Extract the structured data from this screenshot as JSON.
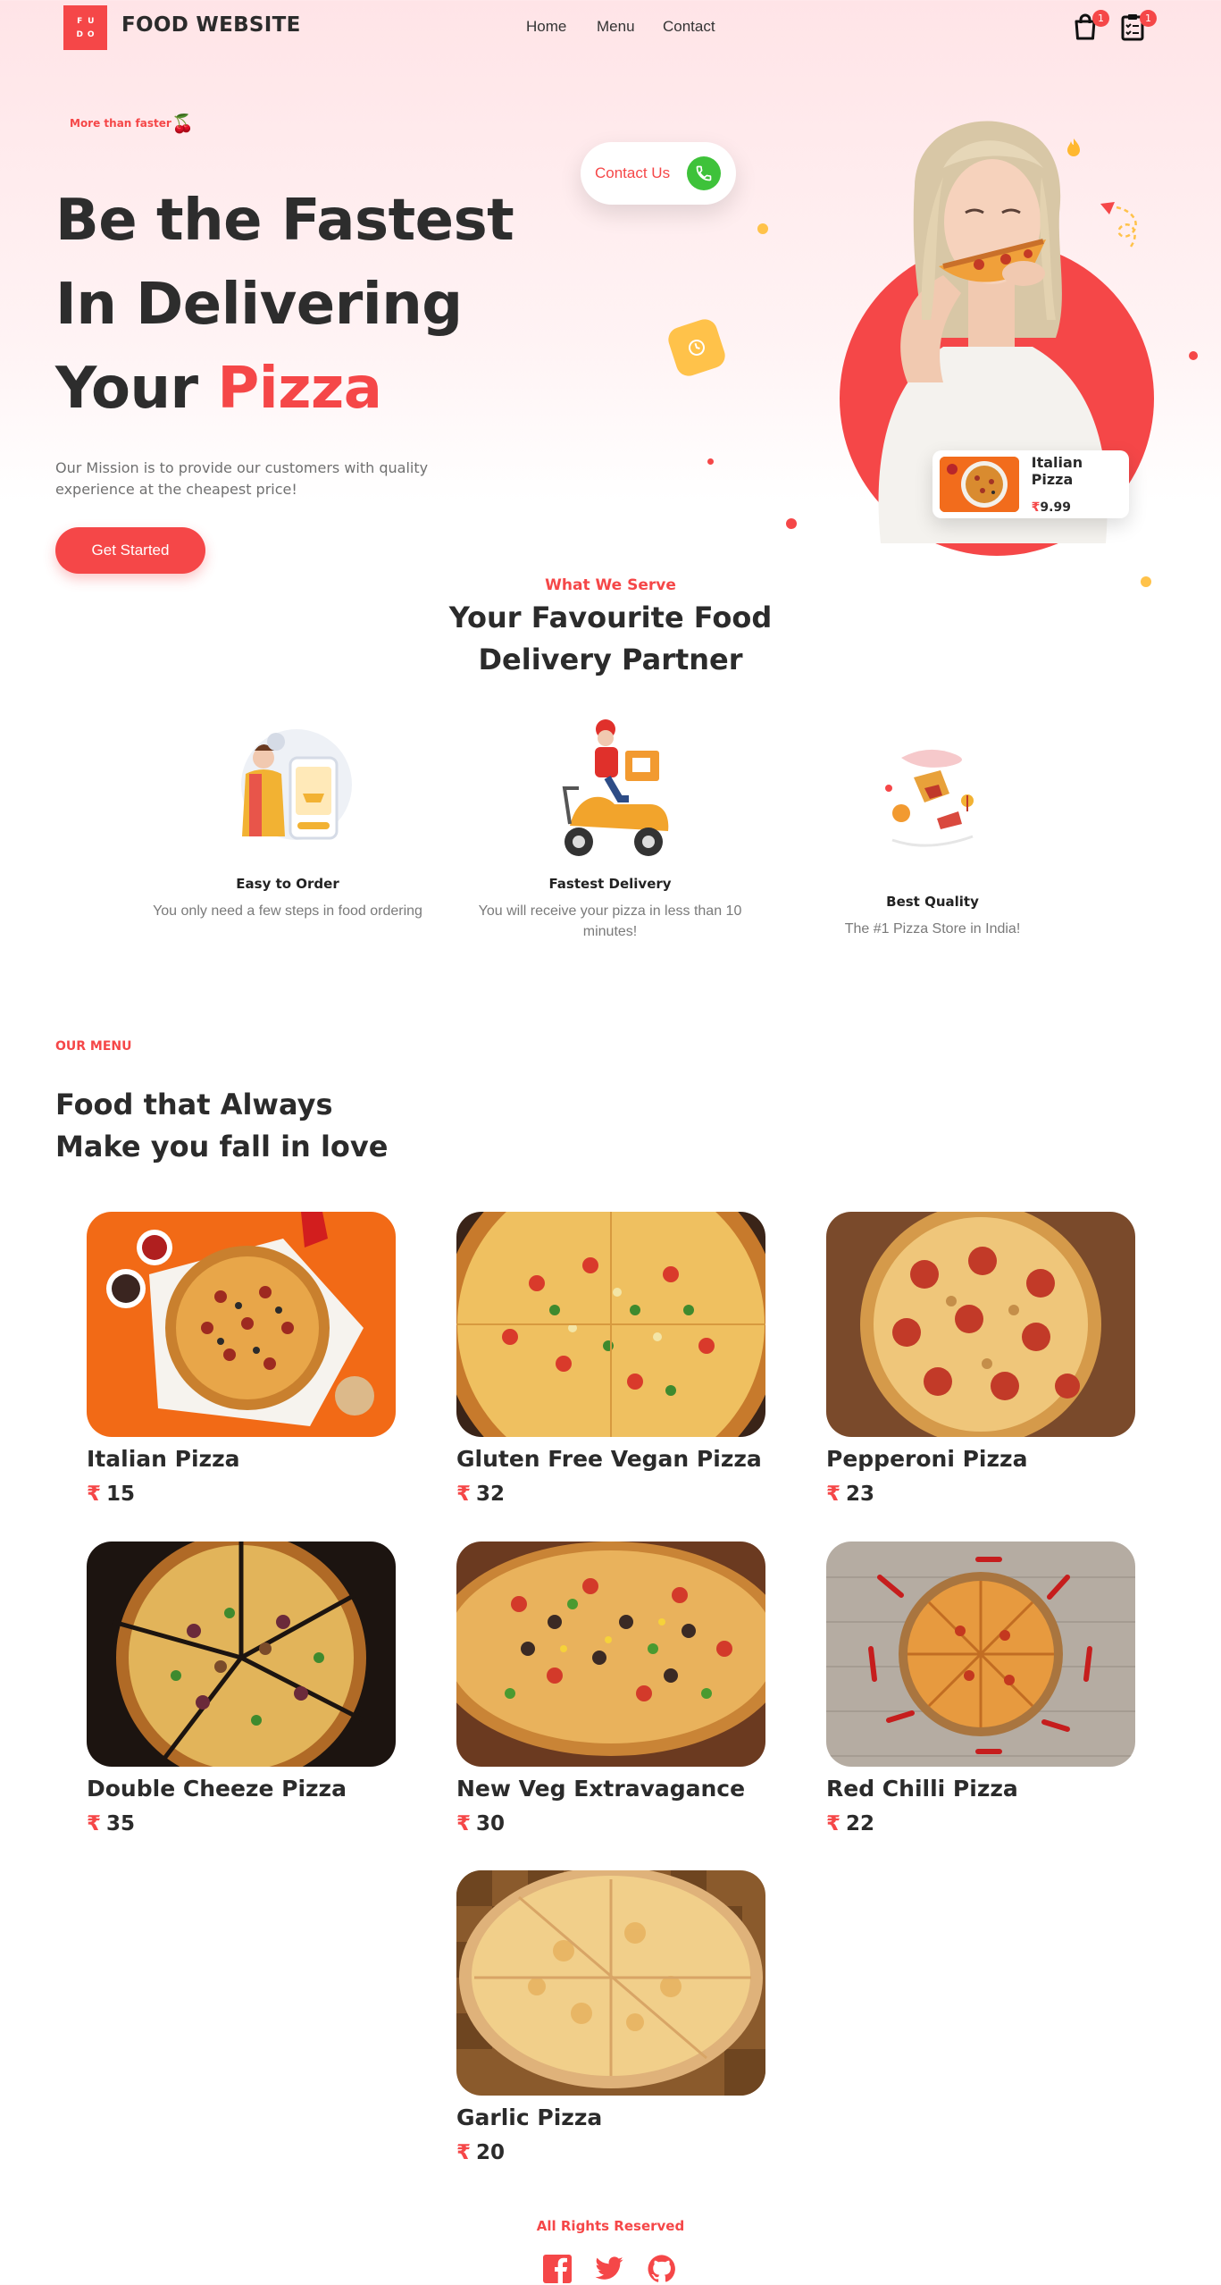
{
  "header": {
    "logo_letters": [
      "F",
      "U",
      "D",
      "O"
    ],
    "brand": "FOOD WEBSITE",
    "nav": [
      "Home",
      "Menu",
      "Contact"
    ],
    "cart_count": "1",
    "orders_count": "1"
  },
  "hero": {
    "tagline": "More than faster",
    "title_line1": "Be the Fastest",
    "title_line2": "In Delivering",
    "title_line3_plain": "Your ",
    "title_line3_accent": "Pizza",
    "subtitle": "Our Mission is to provide our customers with quality experience at the cheapest price!",
    "cta": "Get Started",
    "contact_label": "Contact Us",
    "featured": {
      "name": "Italian Pizza",
      "currency": "₹",
      "price": "9.99"
    }
  },
  "serve": {
    "kicker": "What We Serve",
    "title_line1": "Your Favourite Food",
    "title_line2": "Delivery Partner",
    "features": [
      {
        "title": "Easy to Order",
        "desc": "You only need a few steps in food ordering"
      },
      {
        "title": "Fastest Delivery",
        "desc": "You will receive your pizza in less than 10 minutes!"
      },
      {
        "title": "Best Quality",
        "desc": "The #1 Pizza Store in India!"
      }
    ]
  },
  "menu": {
    "kicker": "OUR MENU",
    "title_line1": "Food that Always",
    "title_line2": "Make you fall in love",
    "currency": "₹",
    "items": [
      {
        "name": "Italian Pizza",
        "price": "15"
      },
      {
        "name": "Gluten Free Vegan Pizza",
        "price": "32"
      },
      {
        "name": "Pepperoni Pizza",
        "price": "23"
      },
      {
        "name": "Double Cheeze Pizza",
        "price": "35"
      },
      {
        "name": "New Veg Extravagance",
        "price": "30"
      },
      {
        "name": "Red Chilli Pizza",
        "price": "22"
      },
      {
        "name": "Garlic Pizza",
        "price": "20"
      }
    ]
  },
  "footer": {
    "rights": "All Rights Reserved",
    "social_icons": [
      "facebook-icon",
      "twitter-icon",
      "github-icon"
    ]
  },
  "colors": {
    "accent": "#f54748",
    "green": "#3ec23a",
    "yellow": "#ffc24a",
    "text": "#2b2b2b"
  }
}
